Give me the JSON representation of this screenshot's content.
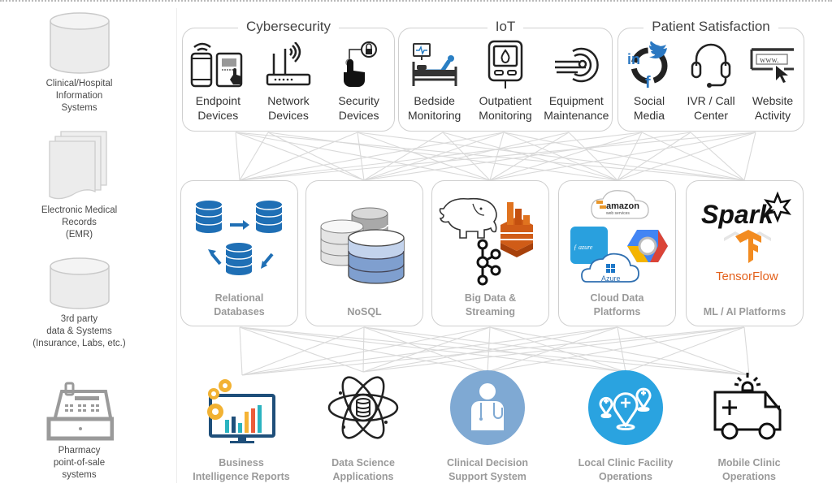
{
  "sources": [
    {
      "label_lines": [
        "Clinical/Hospital",
        "Information",
        "Systems"
      ],
      "icon": "database-cylinder-icon"
    },
    {
      "label_lines": [
        "Electronic Medical",
        "Records",
        "(EMR)"
      ],
      "icon": "document-stack-icon"
    },
    {
      "label_lines": [
        "3rd party",
        "data & Systems",
        "(Insurance, Labs, etc.)"
      ],
      "icon": "database-cylinder-icon"
    },
    {
      "label_lines": [
        "Pharmacy",
        "point-of-sale",
        "systems"
      ],
      "icon": "cash-register-icon"
    }
  ],
  "groups": [
    {
      "title": "Cybersecurity",
      "items": [
        {
          "label_lines": [
            "Endpoint",
            "Devices"
          ],
          "icon": "phone-tablet-icon"
        },
        {
          "label_lines": [
            "Network",
            "Devices"
          ],
          "icon": "router-icon"
        },
        {
          "label_lines": [
            "Security",
            "Devices"
          ],
          "icon": "fingerprint-lock-icon"
        }
      ]
    },
    {
      "title": "IoT",
      "items": [
        {
          "label_lines": [
            "Bedside",
            "Monitoring"
          ],
          "icon": "hospital-bed-monitor-icon"
        },
        {
          "label_lines": [
            "Outpatient",
            "Monitoring"
          ],
          "icon": "glucose-meter-icon"
        },
        {
          "label_lines": [
            "Equipment",
            "Maintenance"
          ],
          "icon": "mri-scanner-icon"
        }
      ]
    },
    {
      "title": "Patient Satisfaction",
      "items": [
        {
          "label_lines": [
            "Social",
            "Media"
          ],
          "icon": "social-media-icon",
          "glyphs": {
            "linkedin": "in",
            "facebook": "f"
          }
        },
        {
          "label_lines": [
            "IVR / Call",
            "Center"
          ],
          "icon": "headset-icon"
        },
        {
          "label_lines": [
            "Website",
            "Activity"
          ],
          "icon": "browser-cursor-icon",
          "url_text": "www."
        }
      ]
    }
  ],
  "platforms": [
    {
      "label_lines": [
        "Relational",
        "Databases"
      ],
      "icon": "relational-db-sync-icon"
    },
    {
      "label_lines": [
        "NoSQL"
      ],
      "icon": "nosql-db-stack-icon"
    },
    {
      "label_lines": [
        "Big Data &",
        "Streaming"
      ],
      "icon": "hadoop-kinesis-kafka-icon"
    },
    {
      "label_lines": [
        "Cloud Data",
        "Platforms"
      ],
      "icon": "cloud-providers-icon",
      "logos": {
        "aws_top": "amazon",
        "aws_sub": "web services",
        "functions": "ƒ azure",
        "azure": "Azure"
      }
    },
    {
      "label_lines": [
        "ML / AI Platforms"
      ],
      "icon": "spark-tensorflow-icon",
      "logos": {
        "spark": "Spark",
        "tensorflow": "TensorFlow"
      }
    }
  ],
  "applications": [
    {
      "label_lines": [
        "Business",
        "Intelligence Reports"
      ],
      "icon": "bi-dashboard-icon"
    },
    {
      "label_lines": [
        "Data Science",
        "Applications"
      ],
      "icon": "atom-database-icon"
    },
    {
      "label_lines": [
        "Clinical Decision",
        "Support System"
      ],
      "icon": "doctor-icon"
    },
    {
      "label_lines": [
        "Local Clinic Facility",
        "Operations"
      ],
      "icon": "clinic-locations-icon"
    },
    {
      "label_lines": [
        "Mobile Clinic",
        "Operations"
      ],
      "icon": "ambulance-icon"
    }
  ],
  "colors": {
    "blue_db": "#1f6fb5",
    "cds_circle": "#7fa9d3",
    "clinic_circle": "#2aa3e0",
    "aws_orange": "#d05c17",
    "tf_orange": "#f28b20",
    "label_gray": "#9a9a9a",
    "line_gray": "#d9d9d9"
  }
}
